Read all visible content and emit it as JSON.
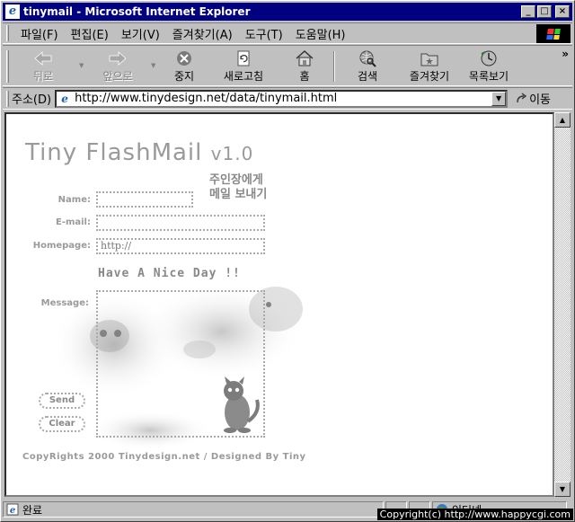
{
  "window": {
    "title": "tinymail - Microsoft Internet Explorer"
  },
  "menu": [
    "파일(F)",
    "편집(E)",
    "보기(V)",
    "즐겨찾기(A)",
    "도구(T)",
    "도움말(H)"
  ],
  "toolbar": {
    "back": "뒤로",
    "forward": "앞으로",
    "stop": "중지",
    "refresh": "새로고침",
    "home": "홈",
    "search": "검색",
    "favorites": "즐겨찾기",
    "history": "목록보기",
    "more": "»"
  },
  "address": {
    "label": "주소(D)",
    "url": "http://www.tinydesign.net/data/tinymail.html",
    "go": "이동"
  },
  "page": {
    "logo": "Tiny FlashMail",
    "version": "v1.0",
    "korean_title_1": "주인장에게",
    "korean_title_2": "메일 보내기",
    "name_label": "Name:",
    "email_label": "E-mail:",
    "homepage_label": "Homepage:",
    "homepage_value": "http://",
    "greeting": "Have A Nice Day !!",
    "message_label": "Message:",
    "send": "Send",
    "clear": "Clear",
    "copyright": "CopyRights 2000 Tinydesign.net / Designed By Tiny"
  },
  "status": {
    "text": "완료",
    "zone": "인터넷"
  },
  "watermark": "Copyright(c) http://www.happycgi.com"
}
